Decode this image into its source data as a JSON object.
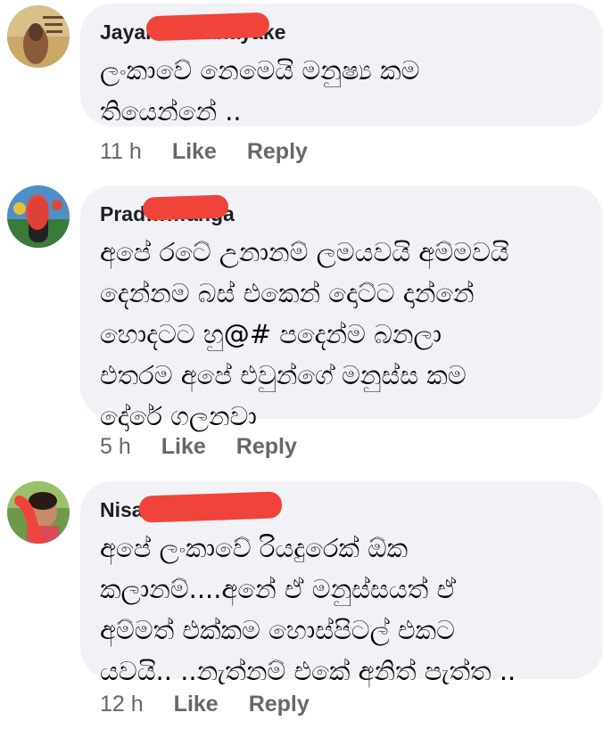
{
  "comments": [
    {
      "author": "Jayal……hanayake",
      "text": "ලංකාවේ නෙමෙයි  මනුෂ්‍ය කම\nතියෙන්නේ ..",
      "time": "11 h",
      "like": "Like",
      "reply": "Reply"
    },
    {
      "author": "Prad……anga",
      "text": "අපේ රටේ උනානම්  ලමයවයි අම්මවයි\nදෙන්නම බස් එකෙන් දොට්ට දාන්නේ\nහොදටට  හු@# පදෙන්ම බනලා\nඑතරම  අපේ එවුන්ගේ මනුස්ස කම\nදෝරේ ගලනවා",
      "time": "5 h",
      "like": "Like",
      "reply": "Reply"
    },
    {
      "author": "Nisa……na",
      "text": "අපේ ලංකාවේ රියදුරෙක් ඕක\nකලානම්....අනේ ඒ මනුස්සයත් ඒ\nඅම්මත් එක්කම හොස්පිටල් එකට\nයවයි.. ..නැත්නම් එකේ අනිත් පැත්ත ..",
      "time": "12 h",
      "like": "Like",
      "reply": "Reply"
    }
  ],
  "colors": {
    "bubble": "#f0f2f5",
    "meta": "#65676b",
    "redaction": "#f0443a"
  }
}
